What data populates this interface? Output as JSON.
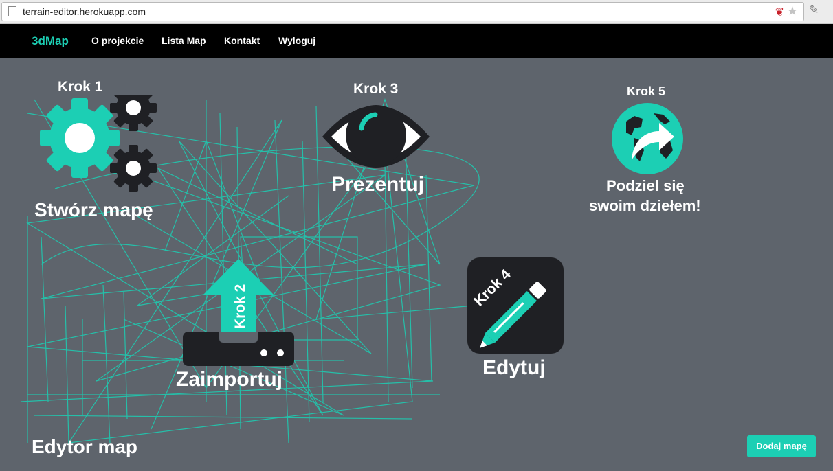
{
  "browser": {
    "url": "terrain-editor.herokuapp.com",
    "icons": [
      "page-icon",
      "red-extension-icon",
      "bookmark-star-icon",
      "eyedropper-icon"
    ]
  },
  "nav": {
    "brand": "3dMap",
    "links": [
      "O projekcie",
      "Lista Map",
      "Kontakt",
      "Wyloguj"
    ]
  },
  "steps": {
    "step1": {
      "krok": "Krok 1",
      "title": "Stwórz mapę",
      "icon": "gears-icon"
    },
    "step2": {
      "krok": "Krok 2",
      "title": "Zaimportuj",
      "icon": "upload-arrow-icon"
    },
    "step3": {
      "krok": "Krok 3",
      "title": "Prezentuj",
      "icon": "eye-icon"
    },
    "step4": {
      "krok": "Krok 4",
      "title": "Edytuj",
      "icon": "pencil-icon"
    },
    "step5": {
      "krok": "Krok 5",
      "title_line1": "Podziel się",
      "title_line2": "swoim dziełem!",
      "icon": "globe-share-icon"
    }
  },
  "footer": {
    "title": "Edytor map",
    "button": "Dodaj mapę"
  },
  "colors": {
    "accent": "#1ccfb4",
    "nav_bg": "#000000",
    "hero_bg": "#5e646c",
    "icon_dark": "#1f2024"
  }
}
